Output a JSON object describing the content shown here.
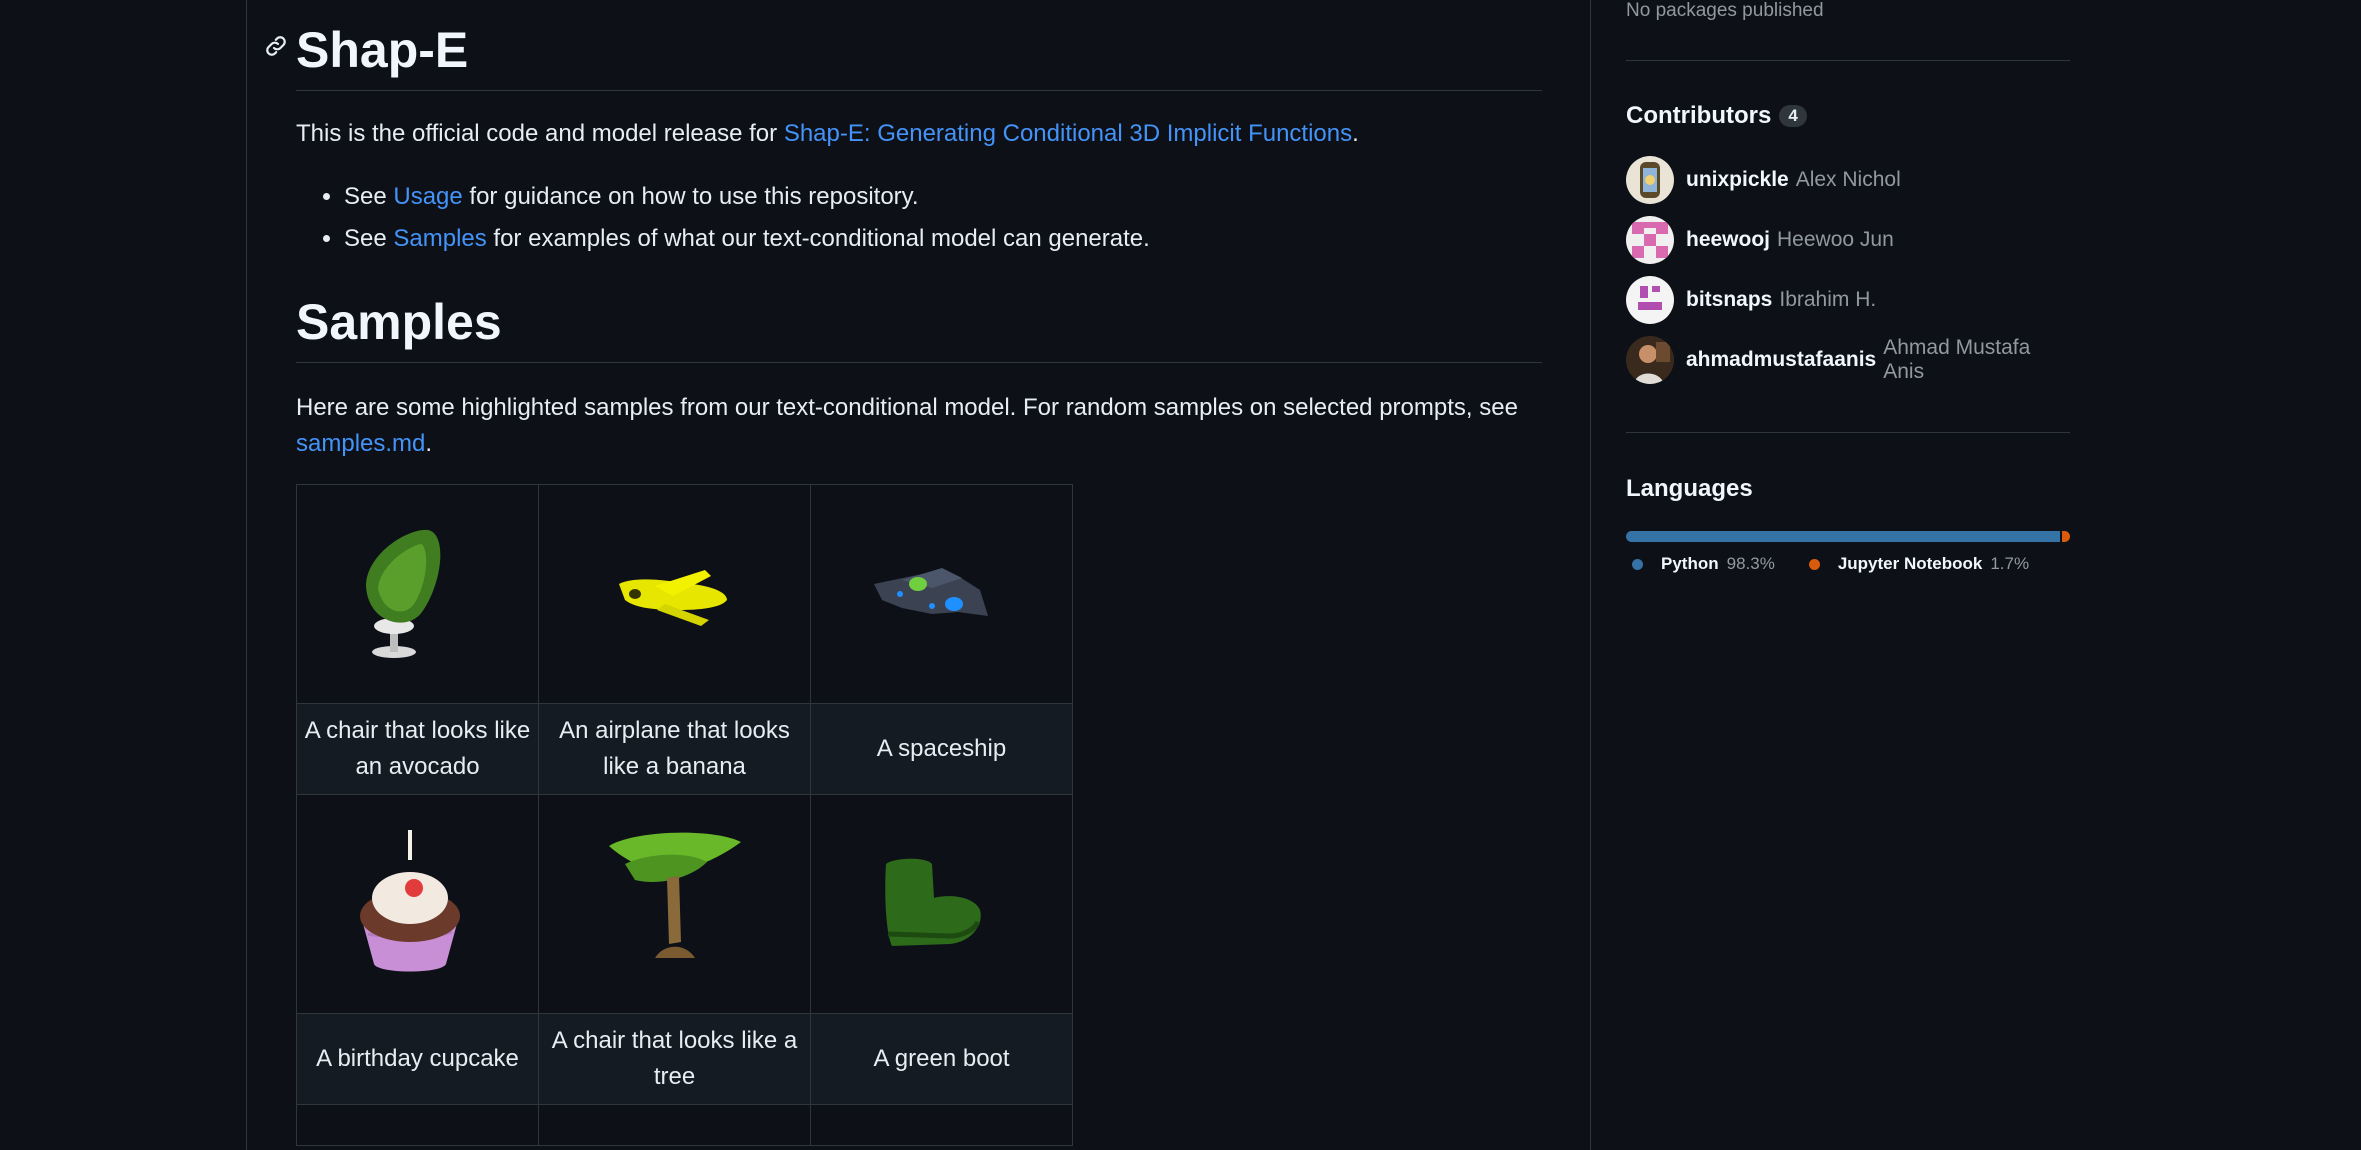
{
  "readme": {
    "title": "Shap-E",
    "intro_prefix": "This is the official code and model release for ",
    "intro_link": "Shap-E: Generating Conditional 3D Implicit Functions",
    "intro_suffix": ".",
    "bullets": [
      {
        "prefix": "See ",
        "link": "Usage",
        "suffix": " for guidance on how to use this repository."
      },
      {
        "prefix": "See ",
        "link": "Samples",
        "suffix": " for examples of what our text-conditional model can generate."
      }
    ],
    "samples_heading": "Samples",
    "samples_intro": "Here are some highlighted samples from our text-conditional model. For random samples on selected prompts, see ",
    "samples_link": "samples.md",
    "samples_suffix": ".",
    "samples": [
      {
        "caption": "A chair that looks like an avocado",
        "icon": "avocado-chair-image"
      },
      {
        "caption": "An airplane that looks like a banana",
        "icon": "banana-airplane-image"
      },
      {
        "caption": "A spaceship",
        "icon": "spaceship-image"
      },
      {
        "caption": "A birthday cupcake",
        "icon": "cupcake-image"
      },
      {
        "caption": "A chair that looks like a tree",
        "icon": "tree-chair-image"
      },
      {
        "caption": "A green boot",
        "icon": "green-boot-image"
      }
    ]
  },
  "sidebar": {
    "packages_text": "No packages published",
    "contributors_title": "Contributors",
    "contributors_count": "4",
    "contributors": [
      {
        "login": "unixpickle",
        "name": "Alex Nichol"
      },
      {
        "login": "heewooj",
        "name": "Heewoo Jun"
      },
      {
        "login": "bitsnaps",
        "name": "Ibrahim H."
      },
      {
        "login": "ahmadmustafaanis",
        "name": "Ahmad Mustafa Anis"
      }
    ],
    "languages_title": "Languages",
    "languages": [
      {
        "name": "Python",
        "percent": "98.3%",
        "share": 98.3,
        "color": "#3572A5"
      },
      {
        "name": "Jupyter Notebook",
        "percent": "1.7%",
        "share": 1.7,
        "color": "#DA5B0B"
      }
    ]
  },
  "colors": {
    "link": "#4493f8",
    "background": "#0d1117",
    "border": "#30363d"
  }
}
